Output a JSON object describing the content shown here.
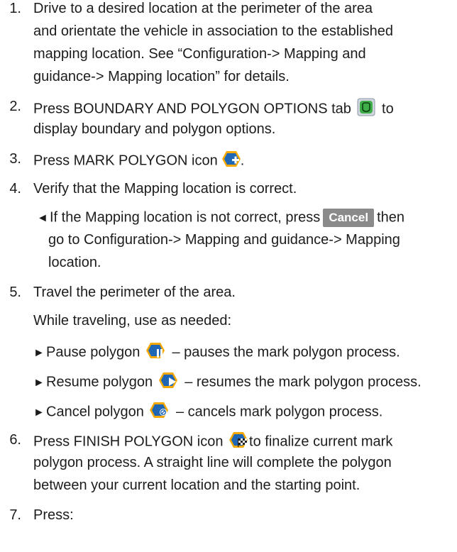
{
  "steps": [
    {
      "number": "1.",
      "lines": [
        "Drive to a desired location at the perimeter of the area",
        "and orientate the vehicle in association to the established",
        "mapping location. See “Configuration-> Mapping and",
        "guidance-> Mapping location” for details."
      ]
    },
    {
      "number": "2.",
      "line1_before": "Press BOUNDARY AND POLYGON OPTIONS tab",
      "line1_after": "to",
      "line2": "display boundary and polygon options."
    },
    {
      "number": "3.",
      "before": "Press MARK POLYGON icon",
      "after": "."
    },
    {
      "number": "4.",
      "text": "Verify that the Mapping location is correct.",
      "sub": {
        "bullet": "◄",
        "before": "If the Mapping location is not correct, press",
        "button": "Cancel",
        "after": "then",
        "line2": "go to Configuration-> Mapping and guidance-> Mapping",
        "line3": "location."
      }
    },
    {
      "number": "5.",
      "text": "Travel the perimeter of the area.",
      "intro": "While traveling, use as needed:",
      "bullets": [
        {
          "marker": "►",
          "label": "Pause polygon",
          "desc": "– pauses the mark polygon process.",
          "icon": "pause-polygon-icon"
        },
        {
          "marker": "►",
          "label": "Resume polygon",
          "desc": "– resumes the mark polygon process.",
          "icon": "resume-polygon-icon"
        },
        {
          "marker": "►",
          "label": "Cancel polygon",
          "desc": "– cancels mark polygon process.",
          "icon": "cancel-polygon-icon"
        }
      ]
    },
    {
      "number": "6.",
      "before": "Press FINISH POLYGON icon",
      "after": "to finalize current mark",
      "line2": "polygon process. A straight line will complete the polygon",
      "line3": "between your current location and the starting point."
    },
    {
      "number": "7.",
      "text": "Press:"
    }
  ],
  "colors": {
    "text": "#1c1c1c",
    "icon_blue": "#1f67b5",
    "icon_orange": "#f5a800",
    "tab_green": "#3fae49",
    "cancel_bg": "#8a8a8a"
  }
}
